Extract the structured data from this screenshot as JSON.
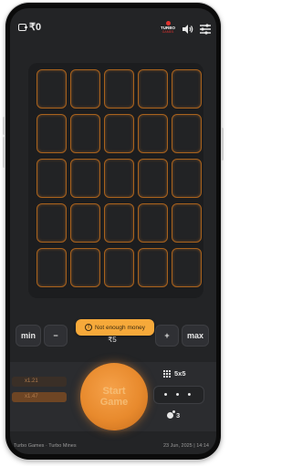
{
  "header": {
    "balance": "₹0",
    "logo_line1": "TURBO",
    "logo_line2": "GAMES",
    "icons": [
      "wallet-icon",
      "speaker-icon",
      "menu-icon"
    ]
  },
  "board": {
    "rows": 5,
    "cols": 5,
    "accent_color": "#a8621d"
  },
  "bet": {
    "min_label": "min",
    "minus_label": "−",
    "amount": "₹5",
    "plus_label": "+",
    "max_label": "max"
  },
  "toast": {
    "message": "Not enough money"
  },
  "history": [
    {
      "value": "x1.21"
    },
    {
      "value": "x1.47"
    }
  ],
  "start_button": {
    "label": "Start Game",
    "color": "#e88a2d"
  },
  "settings": {
    "grid_size": "5x5",
    "more_label": "• • •",
    "mines_count": "3"
  },
  "footer": {
    "left_text": "Turbo Games · Turbo Mines",
    "right_text": "23 Jun, 2025 | 14:14"
  }
}
